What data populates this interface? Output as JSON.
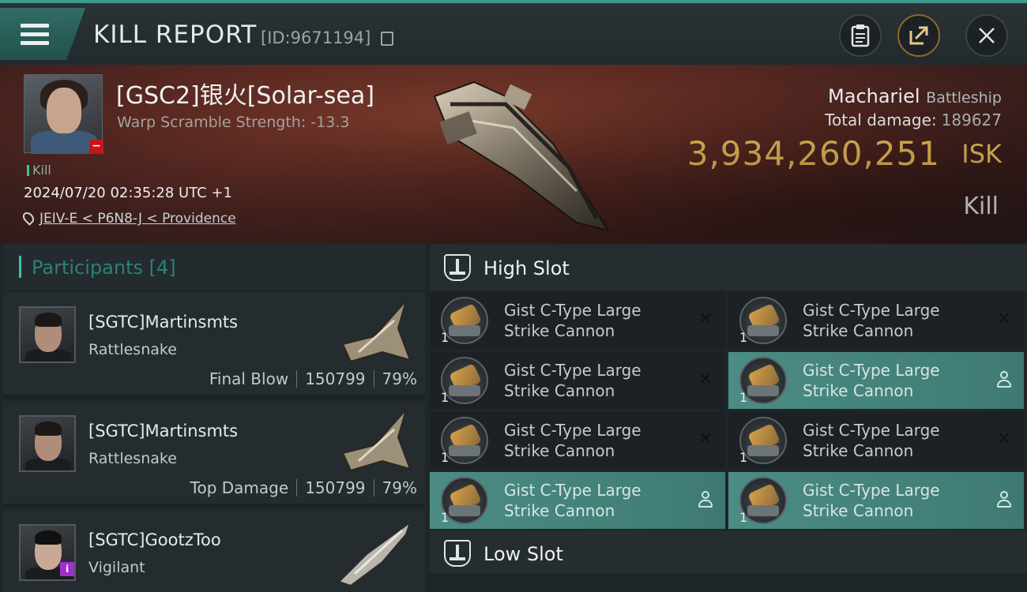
{
  "header": {
    "title": "KILL REPORT",
    "report_id": "[ID:9671194]"
  },
  "victim": {
    "name": "[GSC2]银火[Solar-sea]",
    "warp_scramble": "Warp Scramble Strength: -13.3",
    "kill_tag": "Kill",
    "datetime": "2024/07/20 02:35:28 UTC +1",
    "location": "JEIV-E < P6N8-J < Providence",
    "ship_name": "Machariel",
    "ship_class": "Battleship",
    "total_damage_label": "Total damage:",
    "total_damage": "189627",
    "isk_value": "3,934,260,251",
    "isk_unit": "ISK",
    "result": "Kill"
  },
  "participants": {
    "title": "Participants [4]",
    "rows": [
      {
        "name": "[SGTC]Martinsmts",
        "ship": "Rattlesnake",
        "role": "Final Blow",
        "damage": "150799",
        "percent": "79%"
      },
      {
        "name": "[SGTC]Martinsmts",
        "ship": "Rattlesnake",
        "role": "Top Damage",
        "damage": "150799",
        "percent": "79%"
      },
      {
        "name": "[SGTC]GootzToo",
        "ship": "Vigilant",
        "role": "",
        "damage": "",
        "percent": ""
      }
    ]
  },
  "slots": {
    "high_title": "High Slot",
    "low_title": "Low Slot",
    "high_modules": [
      {
        "line1": "Gist C-Type Large",
        "line2": "Strike Cannon",
        "qty": "1",
        "state": "destroyed"
      },
      {
        "line1": "Gist C-Type Large",
        "line2": "Strike Cannon",
        "qty": "1",
        "state": "destroyed"
      },
      {
        "line1": "Gist C-Type Large",
        "line2": "Strike Cannon",
        "qty": "1",
        "state": "destroyed"
      },
      {
        "line1": "Gist C-Type Large",
        "line2": "Strike Cannon",
        "qty": "1",
        "state": "dropped"
      },
      {
        "line1": "Gist C-Type Large",
        "line2": "Strike Cannon",
        "qty": "1",
        "state": "destroyed"
      },
      {
        "line1": "Gist C-Type Large",
        "line2": "Strike Cannon",
        "qty": "1",
        "state": "destroyed"
      },
      {
        "line1": "Gist C-Type Large",
        "line2": "Strike Cannon",
        "qty": "1",
        "state": "dropped"
      },
      {
        "line1": "Gist C-Type Large",
        "line2": "Strike Cannon",
        "qty": "1",
        "state": "dropped"
      }
    ]
  },
  "colors": {
    "accent": "#3e9a8d",
    "isk": "#f0c05a",
    "active_module": "#4b8c84"
  }
}
